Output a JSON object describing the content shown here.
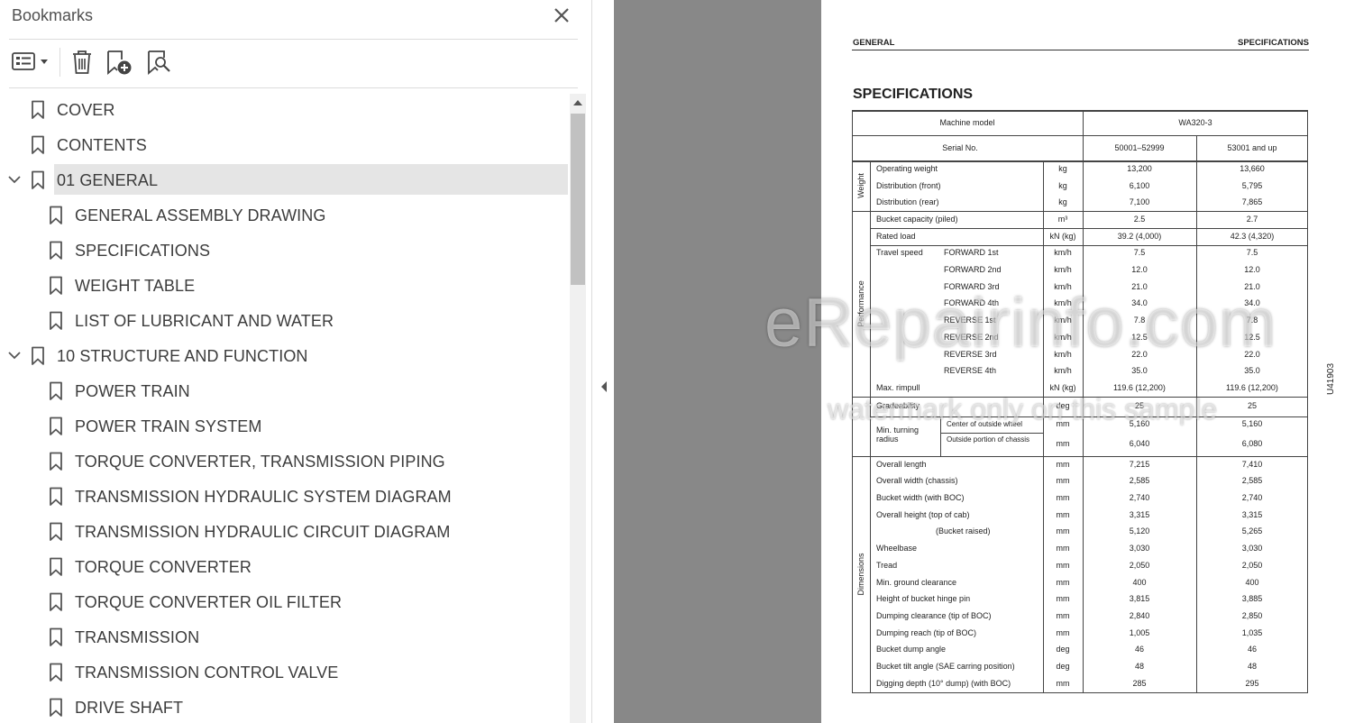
{
  "panel": {
    "title": "Bookmarks",
    "close_icon": "close-icon",
    "toolbar": [
      {
        "name": "options-menu-icon",
        "label": ""
      },
      {
        "name": "delete-bookmark-icon",
        "label": ""
      },
      {
        "name": "new-bookmark-icon",
        "label": ""
      },
      {
        "name": "find-bookmark-icon",
        "label": ""
      }
    ]
  },
  "bookmarks": [
    {
      "label": "COVER",
      "level": 0,
      "expanded": null,
      "selected": false
    },
    {
      "label": "CONTENTS",
      "level": 0,
      "expanded": null,
      "selected": false
    },
    {
      "label": "01 GENERAL",
      "level": 0,
      "expanded": true,
      "selected": true
    },
    {
      "label": "GENERAL ASSEMBLY DRAWING",
      "level": 1,
      "expanded": null,
      "selected": false
    },
    {
      "label": "SPECIFICATIONS",
      "level": 1,
      "expanded": null,
      "selected": false
    },
    {
      "label": "WEIGHT TABLE",
      "level": 1,
      "expanded": null,
      "selected": false
    },
    {
      "label": "LIST OF LUBRICANT AND WATER",
      "level": 1,
      "expanded": null,
      "selected": false
    },
    {
      "label": "10 STRUCTURE AND FUNCTION",
      "level": 0,
      "expanded": true,
      "selected": false
    },
    {
      "label": "POWER TRAIN",
      "level": 1,
      "expanded": null,
      "selected": false
    },
    {
      "label": "POWER TRAIN SYSTEM",
      "level": 1,
      "expanded": null,
      "selected": false
    },
    {
      "label": "TORQUE CONVERTER, TRANSMISSION PIPING",
      "level": 1,
      "expanded": null,
      "selected": false
    },
    {
      "label": "TRANSMISSION HYDRAULIC SYSTEM DIAGRAM",
      "level": 1,
      "expanded": null,
      "selected": false
    },
    {
      "label": "TRANSMISSION HYDRAULIC CIRCUIT DIAGRAM",
      "level": 1,
      "expanded": null,
      "selected": false
    },
    {
      "label": "TORQUE CONVERTER",
      "level": 1,
      "expanded": null,
      "selected": false
    },
    {
      "label": "TORQUE CONVERTER OIL FILTER",
      "level": 1,
      "expanded": null,
      "selected": false
    },
    {
      "label": "TRANSMISSION",
      "level": 1,
      "expanded": null,
      "selected": false
    },
    {
      "label": "TRANSMISSION CONTROL VALVE",
      "level": 1,
      "expanded": null,
      "selected": false
    },
    {
      "label": "DRIVE SHAFT",
      "level": 1,
      "expanded": null,
      "selected": false
    }
  ],
  "document": {
    "header_left": "GENERAL",
    "header_right": "SPECIFICATIONS",
    "title": "SPECIFICATIONS",
    "side_code": "U41903",
    "table": {
      "machine_model_label": "Machine model",
      "machine_model": "WA320-3",
      "serial_label": "Serial No.",
      "serial_a": "50001–52999",
      "serial_b": "53001 and up",
      "groups": {
        "weight": "Weight",
        "performance": "Performance",
        "dimensions": "Dimensions"
      },
      "turning_label": "Min. turning radius",
      "rows": [
        {
          "item": "Operating weight",
          "sub": "",
          "unit": "kg",
          "a": "13,200",
          "b": "13,660"
        },
        {
          "item": "Distribution (front)",
          "sub": "",
          "unit": "kg",
          "a": "6,100",
          "b": "5,795"
        },
        {
          "item": "Distribution (rear)",
          "sub": "",
          "unit": "kg",
          "a": "7,100",
          "b": "7,865"
        },
        {
          "item": "Bucket capacity (piled)",
          "sub": "",
          "unit": "m³",
          "a": "2.5",
          "b": "2.7"
        },
        {
          "item": "Rated load",
          "sub": "",
          "unit": "kN (kg)",
          "a": "39.2 (4,000)",
          "b": "42.3 (4,320)"
        },
        {
          "item": "Travel speed",
          "sub": "FORWARD 1st",
          "unit": "km/h",
          "a": "7.5",
          "b": "7.5"
        },
        {
          "item": "",
          "sub": "FORWARD 2nd",
          "unit": "km/h",
          "a": "12.0",
          "b": "12.0"
        },
        {
          "item": "",
          "sub": "FORWARD 3rd",
          "unit": "km/h",
          "a": "21.0",
          "b": "21.0"
        },
        {
          "item": "",
          "sub": "FORWARD 4th",
          "unit": "km/h",
          "a": "34.0",
          "b": "34.0"
        },
        {
          "item": "",
          "sub": "REVERSE 1st",
          "unit": "km/h",
          "a": "7.8",
          "b": "7.8"
        },
        {
          "item": "",
          "sub": "REVERSE 2nd",
          "unit": "km/h",
          "a": "12.5",
          "b": "12.5"
        },
        {
          "item": "",
          "sub": "REVERSE 3rd",
          "unit": "km/h",
          "a": "22.0",
          "b": "22.0"
        },
        {
          "item": "",
          "sub": "REVERSE 4th",
          "unit": "km/h",
          "a": "35.0",
          "b": "35.0"
        },
        {
          "item": "Max. rimpull",
          "sub": "",
          "unit": "kN (kg)",
          "a": "119.6 (12,200)",
          "b": "119.6 (12,200)"
        },
        {
          "item": "Gradeability",
          "sub": "",
          "unit": "deg",
          "a": "25",
          "b": "25"
        },
        {
          "item": "",
          "sub": "Center of outside wheel",
          "unit": "mm",
          "a": "5,160",
          "b": "5,160"
        },
        {
          "item": "",
          "sub": "Outside portion of chassis",
          "unit": "mm",
          "a": "6,040",
          "b": "6,080"
        },
        {
          "item": "Overall length",
          "sub": "",
          "unit": "mm",
          "a": "7,215",
          "b": "7,410"
        },
        {
          "item": "Overall width (chassis)",
          "sub": "",
          "unit": "mm",
          "a": "2,585",
          "b": "2,585"
        },
        {
          "item": "Bucket width (with BOC)",
          "sub": "",
          "unit": "mm",
          "a": "2,740",
          "b": "2,740"
        },
        {
          "item": "Overall height (top of cab)",
          "sub": "",
          "unit": "mm",
          "a": "3,315",
          "b": "3,315"
        },
        {
          "item": "(Bucket raised)",
          "sub": "",
          "unit": "mm",
          "a": "5,120",
          "b": "5,265"
        },
        {
          "item": "Wheelbase",
          "sub": "",
          "unit": "mm",
          "a": "3,030",
          "b": "3,030"
        },
        {
          "item": "Tread",
          "sub": "",
          "unit": "mm",
          "a": "2,050",
          "b": "2,050"
        },
        {
          "item": "Min. ground clearance",
          "sub": "",
          "unit": "mm",
          "a": "400",
          "b": "400"
        },
        {
          "item": "Height of bucket hinge pin",
          "sub": "",
          "unit": "mm",
          "a": "3,815",
          "b": "3,885"
        },
        {
          "item": "Dumping clearance (tip of BOC)",
          "sub": "",
          "unit": "mm",
          "a": "2,840",
          "b": "2,850"
        },
        {
          "item": "Dumping reach (tip of BOC)",
          "sub": "",
          "unit": "mm",
          "a": "1,005",
          "b": "1,035"
        },
        {
          "item": "Bucket dump angle",
          "sub": "",
          "unit": "deg",
          "a": "46",
          "b": "46"
        },
        {
          "item": "Bucket tilt angle (SAE carring position)",
          "sub": "",
          "unit": "deg",
          "a": "48",
          "b": "48"
        },
        {
          "item": "Digging depth (10° dump) (with BOC)",
          "sub": "",
          "unit": "mm",
          "a": "285",
          "b": "295"
        }
      ]
    }
  },
  "watermark": {
    "main": "eRepairinfo.com",
    "sub": "watermark only on this sample"
  }
}
